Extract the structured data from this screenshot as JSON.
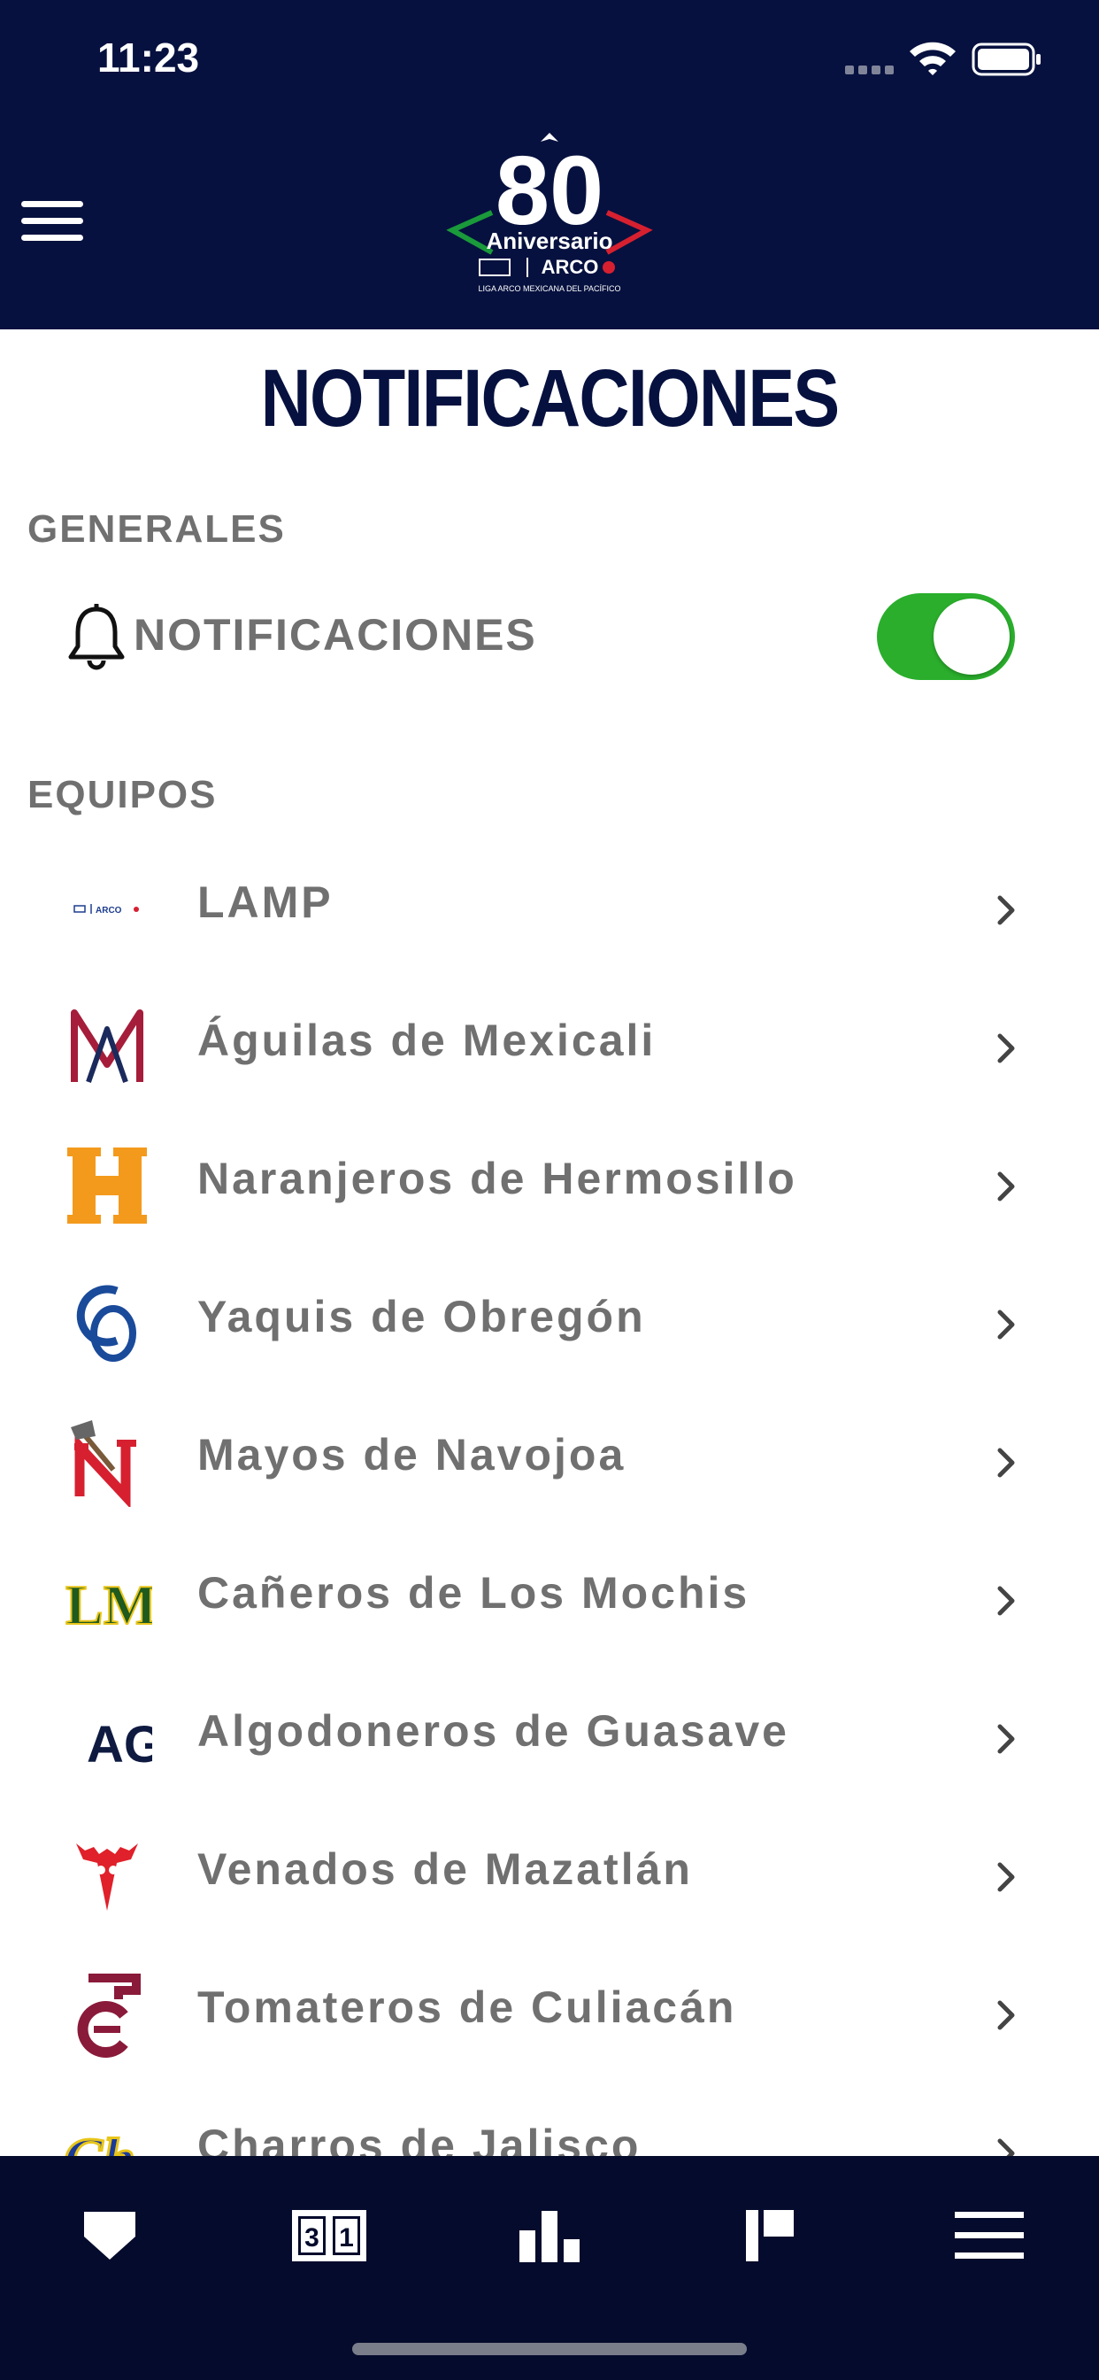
{
  "status_bar": {
    "time": "11:23"
  },
  "header": {
    "logo": {
      "number": "80",
      "line1": "Aniversario",
      "line2": "ARCO",
      "line3": "LIGA ARCO MEXICANA DEL PACÍFICO"
    }
  },
  "page": {
    "title": "NOTIFICACIONES"
  },
  "general": {
    "section_label": "GENERALES",
    "notifications_label": "NOTIFICACIONES",
    "notifications_enabled": true
  },
  "teams": {
    "section_label": "EQUIPOS",
    "items": [
      {
        "name": "LAMP",
        "logo_text": "ARCO"
      },
      {
        "name": "Águilas de Mexicali"
      },
      {
        "name": "Naranjeros de Hermosillo"
      },
      {
        "name": "Yaquis de Obregón"
      },
      {
        "name": "Mayos de Navojoa"
      },
      {
        "name": "Cañeros de Los Mochis"
      },
      {
        "name": "Algodoneros de Guasave"
      },
      {
        "name": "Venados de Mazatlán"
      },
      {
        "name": "Tomateros de Culiacán"
      },
      {
        "name": "Charros de Jalisco"
      }
    ]
  },
  "tab_bar": {
    "tabs": [
      {
        "id": "home",
        "icon": "home-shield-icon"
      },
      {
        "id": "scores",
        "icon": "scoreboard-icon",
        "digits": [
          "3",
          "1"
        ]
      },
      {
        "id": "standings",
        "icon": "bar-chart-icon"
      },
      {
        "id": "stats",
        "icon": "leaderboard-icon"
      },
      {
        "id": "more",
        "icon": "menu-icon"
      }
    ]
  },
  "colors": {
    "header_bg": "#06113f",
    "title": "#06113f",
    "text_gray": "#707070",
    "toggle_on": "#2aae2c",
    "tab_bar_bg": "#040b2c"
  }
}
